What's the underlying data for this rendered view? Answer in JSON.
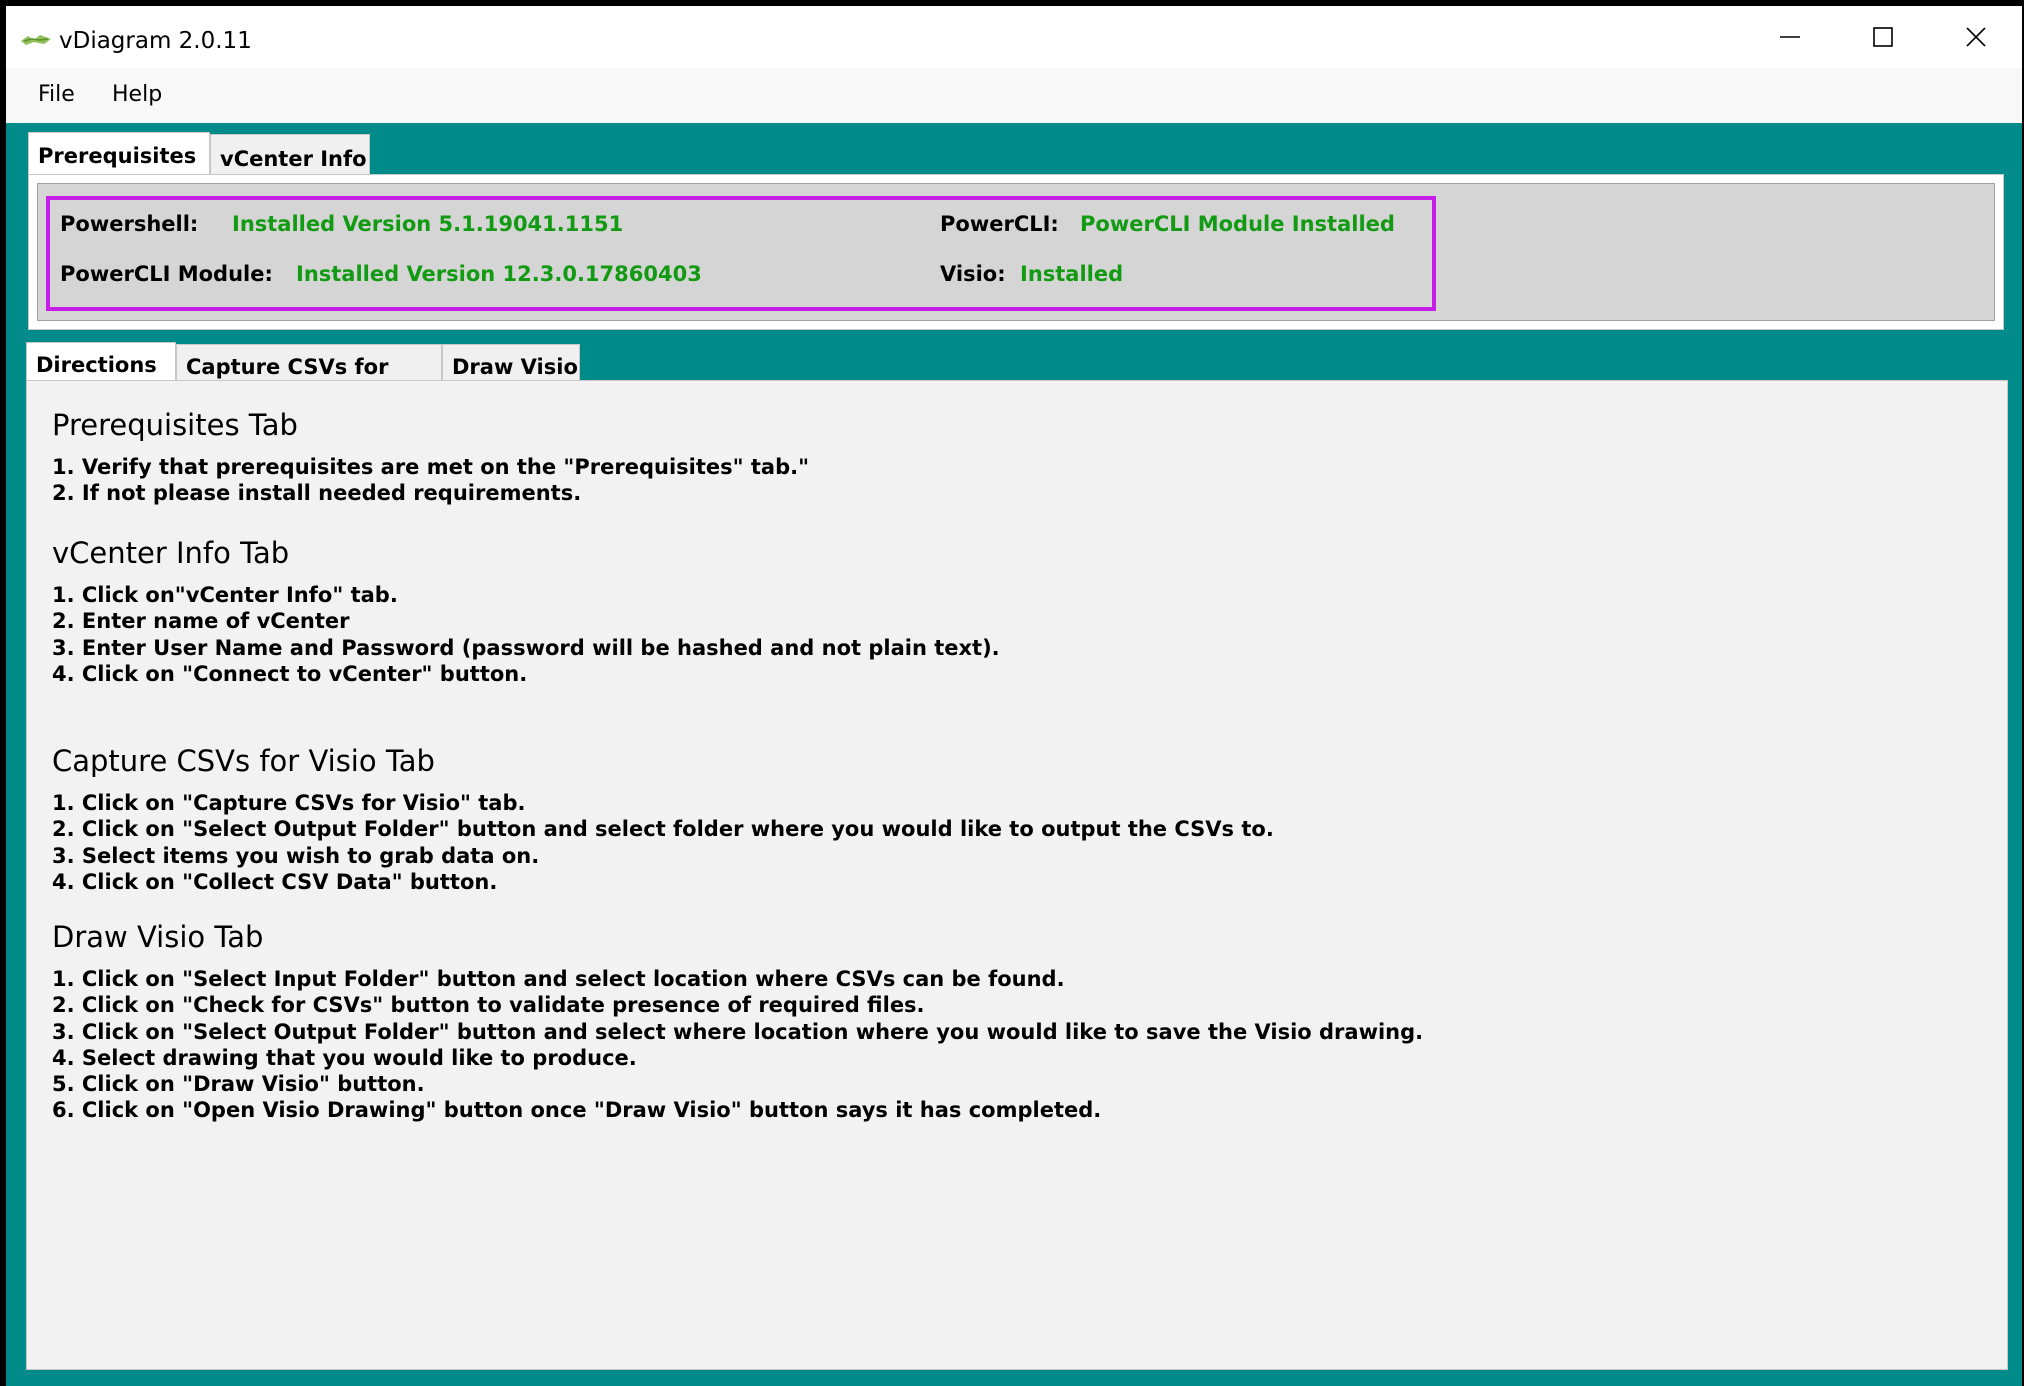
{
  "window": {
    "title": "vDiagram 2.0.11",
    "minimize_icon": "minimize-icon",
    "maximize_icon": "maximize-icon",
    "close_icon": "close-icon"
  },
  "menu": {
    "items": [
      {
        "label": "File"
      },
      {
        "label": "Help"
      }
    ]
  },
  "top_tabs": [
    {
      "label": "Prerequisites",
      "active": true
    },
    {
      "label": "vCenter Info",
      "active": false
    }
  ],
  "prerequisites": {
    "powershell_label": "Powershell:",
    "powershell_value": "Installed Version 5.1.19041.1151",
    "powercli_label": "PowerCLI:",
    "powercli_value": "PowerCLI Module Installed",
    "powercli_module_label": "PowerCLI Module:",
    "powercli_module_value": "Installed Version 12.3.0.17860403",
    "visio_label": "Visio:",
    "visio_value": "Installed",
    "status_color": "#129a12",
    "highlight_color": "#c61ee6"
  },
  "bottom_tabs": [
    {
      "label": "Directions",
      "active": true
    },
    {
      "label": "Capture CSVs for Visio",
      "active": false
    },
    {
      "label": "Draw Visio",
      "active": false
    }
  ],
  "directions": {
    "sections": [
      {
        "title": "Prerequisites Tab",
        "steps": [
          "1. Verify that prerequisites are met on the \"Prerequisites\" tab.\"",
          "2. If not please install needed requirements."
        ]
      },
      {
        "title": "vCenter Info Tab",
        "steps": [
          "1. Click on\"vCenter Info\" tab.",
          "2. Enter name of vCenter",
          "3. Enter User Name and Password (password will be hashed and not plain text).",
          "4. Click on \"Connect to vCenter\" button."
        ]
      },
      {
        "title": "Capture CSVs for Visio Tab",
        "steps": [
          "1. Click on \"Capture CSVs for Visio\" tab.",
          "2. Click on \"Select Output Folder\" button and select folder where you would like to output the CSVs to.",
          "3. Select items you wish to grab data on.",
          "4. Click on \"Collect CSV Data\" button."
        ]
      },
      {
        "title": "Draw Visio Tab",
        "steps": [
          "1. Click on \"Select Input Folder\" button and select location where CSVs can be found.",
          "2. Click on \"Check for CSVs\" button to validate presence of required files.",
          "3. Click on \"Select Output Folder\" button and select where location where you would like to save the Visio drawing.",
          "4. Select drawing that you would like to produce.",
          "5. Click on \"Draw Visio\" button.",
          "6. Click on \"Open Visio Drawing\" button once \"Draw Visio\" button says it has completed."
        ]
      }
    ]
  },
  "colors": {
    "window_background": "#008b8b",
    "panel_background": "#f2f2f2"
  }
}
